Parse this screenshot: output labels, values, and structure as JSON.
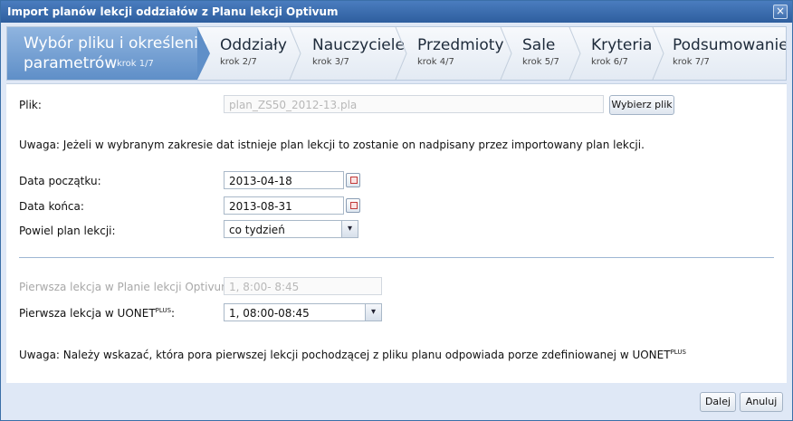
{
  "window": {
    "title": "Import planów lekcji oddziałów z Planu lekcji Optivum",
    "close_glyph": "×"
  },
  "wizard": {
    "steps": [
      {
        "label_line1": "Wybór pliku i określenie",
        "label_line2": "parametrów",
        "step": "krok 1/7"
      },
      {
        "label": "Oddziały",
        "step": "krok 2/7"
      },
      {
        "label": "Nauczyciele",
        "step": "krok 3/7"
      },
      {
        "label": "Przedmioty",
        "step": "krok 4/7"
      },
      {
        "label": "Sale",
        "step": "krok 5/7"
      },
      {
        "label": "Kryteria",
        "step": "krok 6/7"
      },
      {
        "label": "Podsumowanie",
        "step": "krok 7/7"
      }
    ]
  },
  "form": {
    "file_label": "Plik:",
    "file_value": "plan_ZS50_2012-13.pla",
    "choose_file_button": "Wybierz plik",
    "warning1": "Uwaga: Jeżeli w wybranym zakresie dat istnieje plan lekcji to zostanie on nadpisany przez importowany plan lekcji.",
    "start_date_label": "Data początku:",
    "start_date_value": "2013-04-18",
    "end_date_label": "Data końca:",
    "end_date_value": "2013-08-31",
    "repeat_label": "Powiel plan lekcji:",
    "repeat_value": "co tydzień",
    "first_lesson_optivum_label": "Pierwsza lekcja w Planie lekcji Optivum:",
    "first_lesson_optivum_value": "1,  8:00-  8:45",
    "first_lesson_uonet_label": "Pierwsza lekcja w UONET",
    "first_lesson_uonet_sup": "PLUS",
    "first_lesson_uonet_colon": ":",
    "first_lesson_uonet_value": "1, 08:00-08:45",
    "warning2": "Uwaga: Należy wskazać, która pora pierwszej lekcji pochodzącej z pliku planu odpowiada porze zdefiniowanej w UONET",
    "warning2_sup": "PLUS"
  },
  "footer": {
    "next_button": "Dalej",
    "cancel_button": "Anuluj"
  },
  "icons": {
    "dropdown_arrow": "▾"
  },
  "colors": {
    "title_bar": "#2e5e9e",
    "active_step": "#5f8fc8",
    "frame": "#dfe8f6"
  }
}
